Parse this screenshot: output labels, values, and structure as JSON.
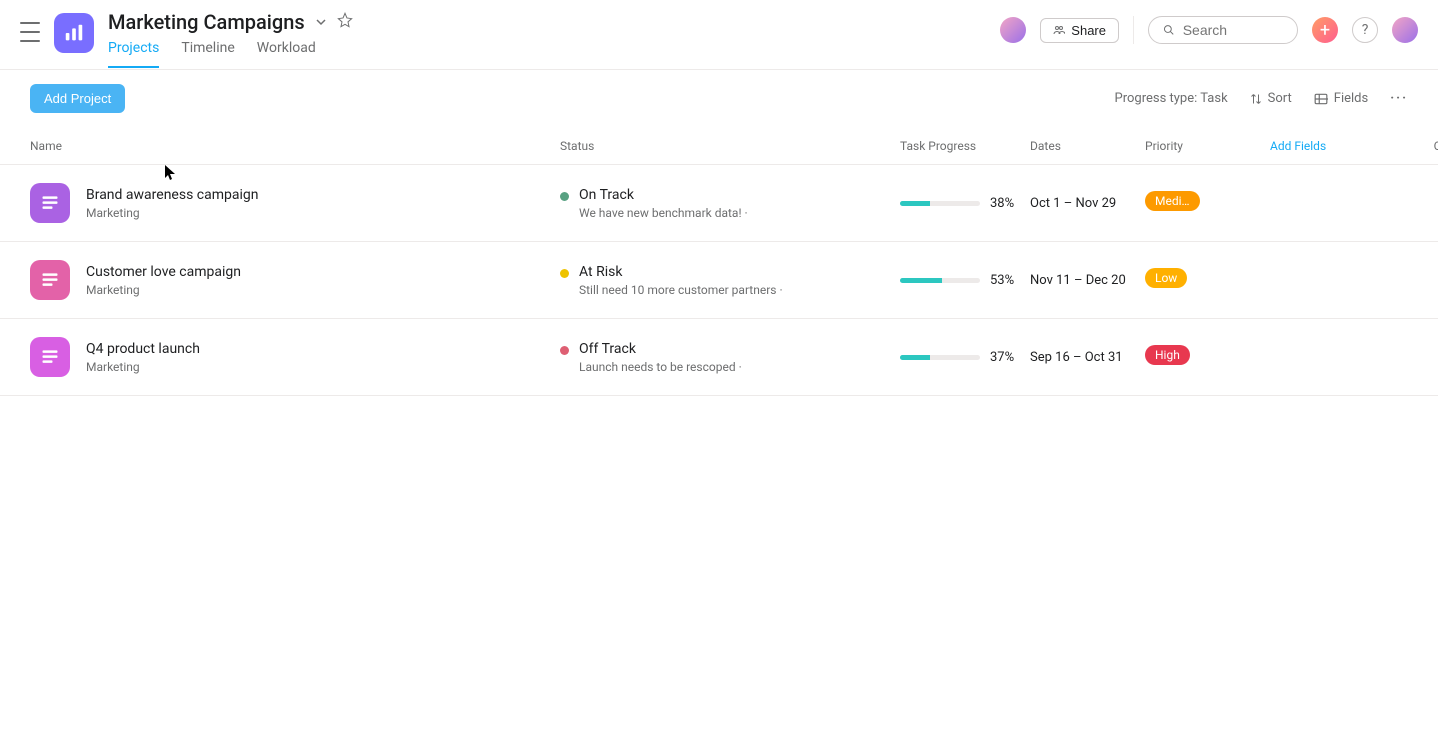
{
  "header": {
    "title": "Marketing Campaigns",
    "tabs": {
      "projects": "Projects",
      "timeline": "Timeline",
      "workload": "Workload"
    },
    "share_label": "Share",
    "search_placeholder": "Search",
    "help_label": "?"
  },
  "toolbar": {
    "add_project_label": "Add Project",
    "progress_type": "Progress type: Task",
    "sort": "Sort",
    "fields": "Fields"
  },
  "columns": {
    "name": "Name",
    "status": "Status",
    "task_progress": "Task Progress",
    "dates": "Dates",
    "priority": "Priority",
    "add_fields": "Add Fields",
    "owner": "Owner"
  },
  "rows": [
    {
      "name": "Brand awareness campaign",
      "team": "Marketing",
      "status_label": "On Track",
      "status_sub": "We have new benchmark data! ·",
      "status_color": "green",
      "progress": 38,
      "progress_pct": "38%",
      "dates": "Oct 1 – Nov 29",
      "priority_label": "Medi…",
      "priority_color": "#fd9a00",
      "icon_class": "ic-purple",
      "avatar_class": "av1"
    },
    {
      "name": "Customer love campaign",
      "team": "Marketing",
      "status_label": "At Risk",
      "status_sub": "Still need 10 more customer partners ·",
      "status_color": "yellow",
      "progress": 53,
      "progress_pct": "53%",
      "dates": "Nov 11 – Dec 20",
      "priority_label": "Low",
      "priority_color": "#ffb000",
      "icon_class": "ic-magenta",
      "avatar_class": "av2"
    },
    {
      "name": "Q4 product launch",
      "team": "Marketing",
      "status_label": "Off Track",
      "status_sub": "Launch needs to be rescoped ·",
      "status_color": "red",
      "progress": 37,
      "progress_pct": "37%",
      "dates": "Sep 16 – Oct 31",
      "priority_label": "High",
      "priority_color": "#e8384f",
      "icon_class": "ic-pink",
      "avatar_class": "av3"
    }
  ]
}
